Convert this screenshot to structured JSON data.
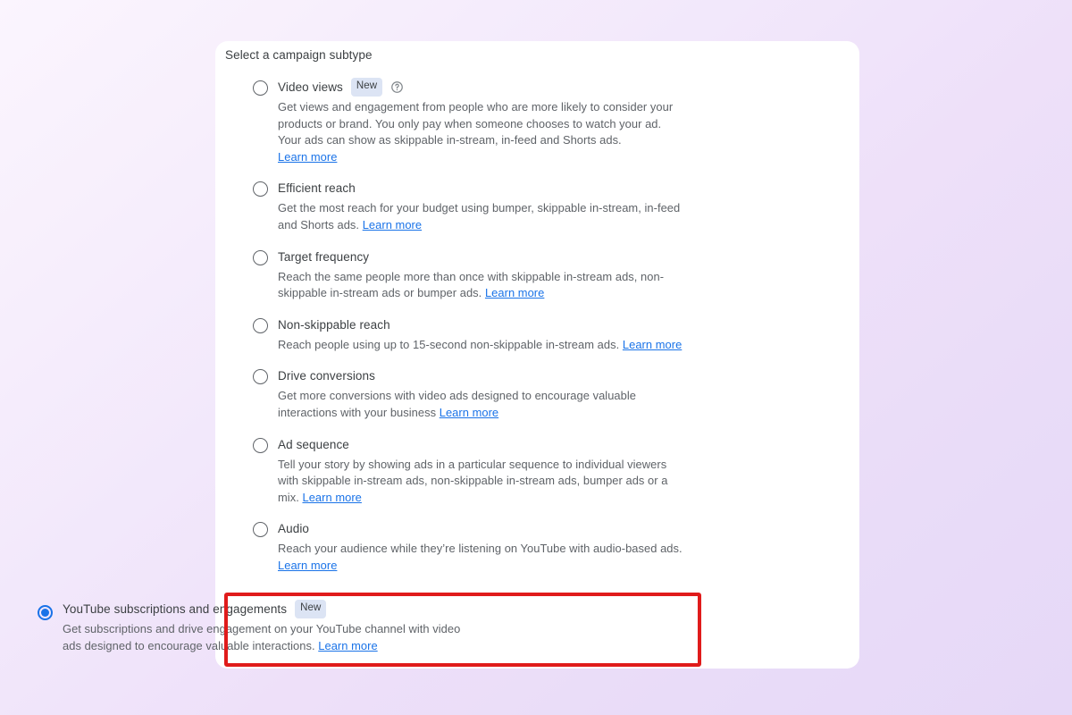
{
  "page": {
    "background_gradient_from": "#fbf5fe",
    "background_gradient_to": "#e6d8f7"
  },
  "card": {
    "title": "Select a campaign subtype",
    "background": "#ffffff"
  },
  "labels": {
    "badge_new": "New",
    "learn_more": "Learn more",
    "help_icon": "help-circle-icon"
  },
  "colors": {
    "accent_blue": "#1a73e8",
    "link_blue": "#1a73e8",
    "badge_bg": "#dce4f4",
    "text_primary": "#3c4043",
    "text_secondary": "#5f6368",
    "highlight_border": "#e01b1b",
    "radio_outline": "#5f6368"
  },
  "options": [
    {
      "id": "video-views",
      "title": "Video views",
      "selected": false,
      "badge": "New",
      "has_help_icon": true,
      "description": "Get views and engagement from people who are more likely to consider your products or brand. You only pay when someone chooses to watch your ad. Your ads can show as skippable in-stream, in-feed and Shorts ads.",
      "learn_more": "Learn more",
      "learn_more_inline": false
    },
    {
      "id": "efficient-reach",
      "title": "Efficient reach",
      "selected": false,
      "badge": null,
      "has_help_icon": false,
      "description": "Get the most reach for your budget using bumper, skippable in-stream, in-feed and Shorts ads.",
      "learn_more": "Learn more",
      "learn_more_inline": true
    },
    {
      "id": "target-frequency",
      "title": "Target frequency",
      "selected": false,
      "badge": null,
      "has_help_icon": false,
      "description": "Reach the same people more than once with skippable in-stream ads, non-skippable in-stream ads or bumper ads.",
      "learn_more": "Learn more",
      "learn_more_inline": true
    },
    {
      "id": "non-skippable-reach",
      "title": "Non-skippable reach",
      "selected": false,
      "badge": null,
      "has_help_icon": false,
      "description": "Reach people using up to 15-second non-skippable in-stream ads.",
      "learn_more": "Learn more",
      "learn_more_inline": true
    },
    {
      "id": "drive-conversions",
      "title": "Drive conversions",
      "selected": false,
      "badge": null,
      "has_help_icon": false,
      "description": "Get more conversions with video ads designed to encourage valuable interactions with your business",
      "learn_more": "Learn more",
      "learn_more_inline": true
    },
    {
      "id": "ad-sequence",
      "title": "Ad sequence",
      "selected": false,
      "badge": null,
      "has_help_icon": false,
      "description": "Tell your story by showing ads in a particular sequence to individual viewers with skippable in-stream ads, non-skippable in-stream ads, bumper ads or a mix.",
      "learn_more": "Learn more",
      "learn_more_inline": true
    },
    {
      "id": "audio",
      "title": "Audio",
      "selected": false,
      "badge": null,
      "has_help_icon": false,
      "description": "Reach your audience while they’re listening on YouTube with audio-based ads.",
      "learn_more": "Learn more",
      "learn_more_inline": false
    },
    {
      "id": "youtube-subscriptions-and-engagements",
      "title": "YouTube subscriptions and engagements",
      "selected": true,
      "badge": "New",
      "has_help_icon": false,
      "description": "Get subscriptions and drive engagement on your YouTube channel with video ads designed to encourage valuable interactions.",
      "learn_more": "Learn more",
      "learn_more_inline": true,
      "highlighted": true
    }
  ]
}
